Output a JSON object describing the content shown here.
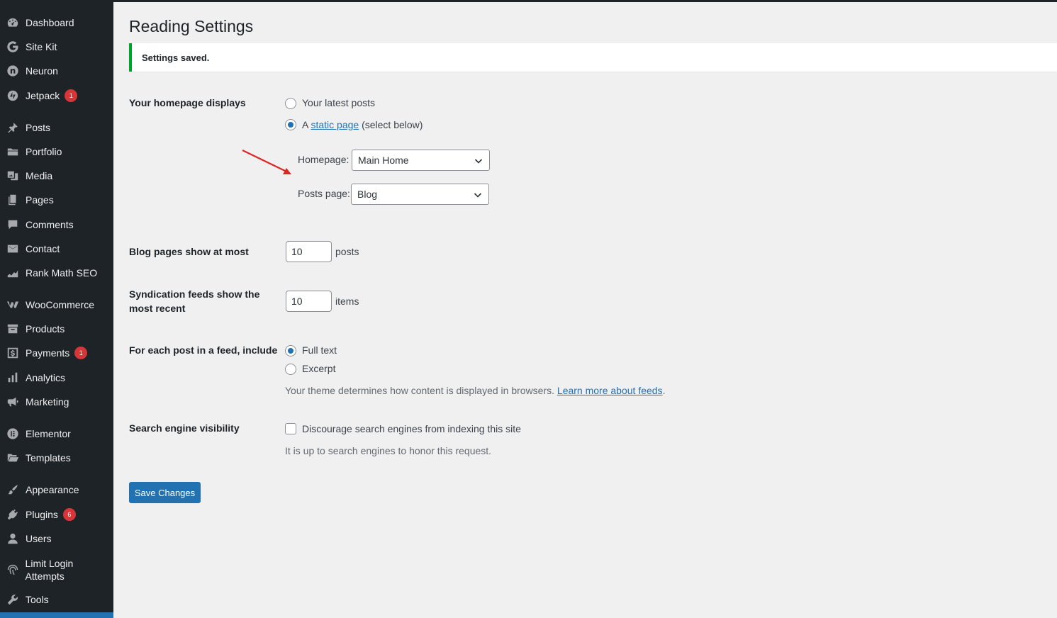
{
  "sidebar": {
    "items": [
      {
        "label": "Dashboard",
        "icon": "dashboard-icon"
      },
      {
        "label": "Site Kit",
        "icon": "google-g-icon"
      },
      {
        "label": "Neuron",
        "icon": "neuron-icon"
      },
      {
        "label": "Jetpack",
        "icon": "jetpack-icon",
        "badge": "1"
      },
      {
        "label": "Posts",
        "icon": "pin-icon"
      },
      {
        "label": "Portfolio",
        "icon": "folder-icon"
      },
      {
        "label": "Media",
        "icon": "media-icon"
      },
      {
        "label": "Pages",
        "icon": "pages-icon"
      },
      {
        "label": "Comments",
        "icon": "comment-icon"
      },
      {
        "label": "Contact",
        "icon": "envelope-icon"
      },
      {
        "label": "Rank Math SEO",
        "icon": "rank-math-icon"
      },
      {
        "label": "WooCommerce",
        "icon": "woocommerce-icon"
      },
      {
        "label": "Products",
        "icon": "archive-icon"
      },
      {
        "label": "Payments",
        "icon": "dollar-icon",
        "badge": "1"
      },
      {
        "label": "Analytics",
        "icon": "bar-chart-icon"
      },
      {
        "label": "Marketing",
        "icon": "megaphone-icon"
      },
      {
        "label": "Elementor",
        "icon": "elementor-icon"
      },
      {
        "label": "Templates",
        "icon": "folder-open-icon"
      },
      {
        "label": "Appearance",
        "icon": "paintbrush-icon"
      },
      {
        "label": "Plugins",
        "icon": "plug-icon",
        "badge": "6"
      },
      {
        "label": "Users",
        "icon": "user-icon"
      },
      {
        "label": "Limit Login Attempts",
        "icon": "fingerprint-icon"
      },
      {
        "label": "Tools",
        "icon": "wrench-icon"
      }
    ]
  },
  "page": {
    "title": "Reading Settings",
    "notice": "Settings saved."
  },
  "homepage": {
    "label": "Your homepage displays",
    "option_latest": "Your latest posts",
    "option_static_prefix": "A ",
    "option_static_link": "static page",
    "option_static_suffix": " (select below)",
    "selected": "static",
    "homepage_label": "Homepage:",
    "homepage_value": "Main Home",
    "posts_page_label": "Posts page:",
    "posts_page_value": "Blog"
  },
  "blog_pages": {
    "label": "Blog pages show at most",
    "value": "10",
    "unit": "posts"
  },
  "syndication": {
    "label_line1": "Syndication feeds show the",
    "label_line2": "most recent",
    "value": "10",
    "unit": "items"
  },
  "feed": {
    "label": "For each post in a feed, include",
    "option_full": "Full text",
    "option_excerpt": "Excerpt",
    "selected": "full",
    "desc_prefix": "Your theme determines how content is displayed in browsers. ",
    "desc_link": "Learn more about feeds",
    "desc_suffix": "."
  },
  "search": {
    "label": "Search engine visibility",
    "checkbox_label": "Discourage search engines from indexing this site",
    "checked": false,
    "desc": "It is up to search engines to honor this request."
  },
  "save_label": "Save Changes",
  "colors": {
    "sidebar_bg": "#1d2327",
    "accent": "#2271b1",
    "success": "#00a32a",
    "badge": "#d63638",
    "annotation_arrow": "#e02424"
  }
}
